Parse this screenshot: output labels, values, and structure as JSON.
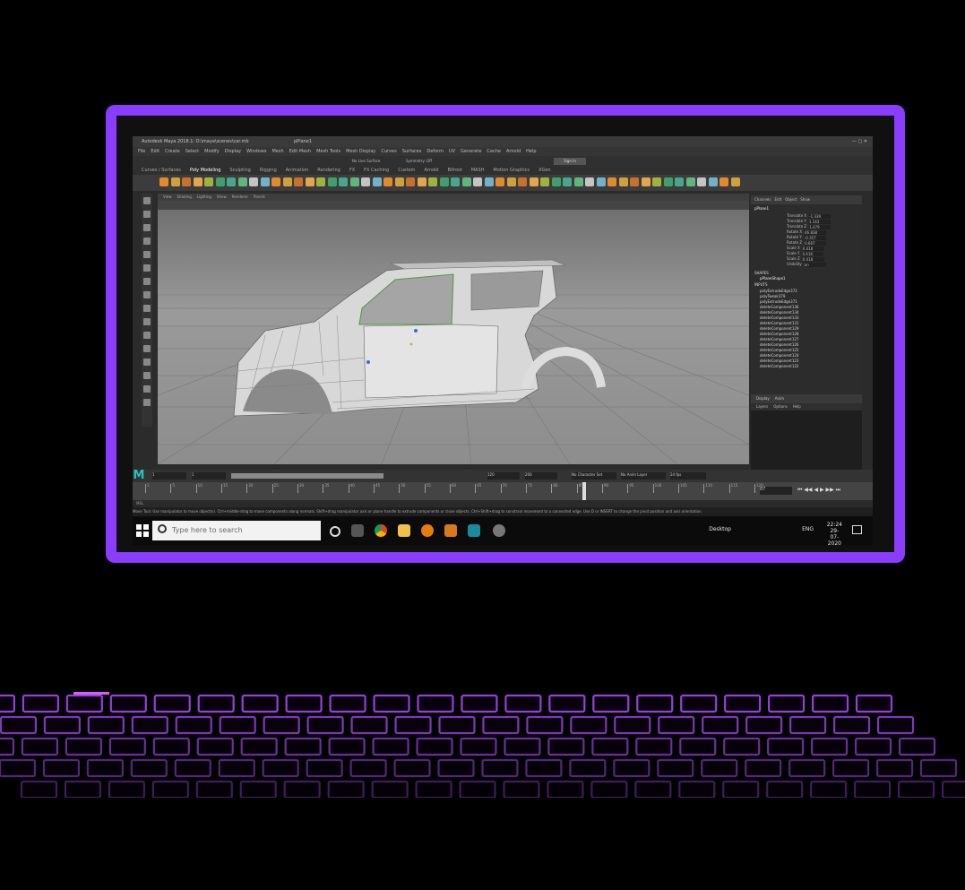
{
  "app": {
    "window_title": "Autodesk Maya 2018.1: D:\\maya\\scenes\\car.mb",
    "object_name": "pPlane1",
    "menus": [
      "File",
      "Edit",
      "Create",
      "Select",
      "Modify",
      "Display",
      "Windows",
      "Mesh",
      "Edit Mesh",
      "Mesh Tools",
      "Mesh Display",
      "Curves",
      "Surfaces",
      "Deform",
      "UV",
      "Generate",
      "Cache",
      "Arnold",
      "Help"
    ],
    "shelf_tabs": [
      "Curves / Surfaces",
      "Poly Modeling",
      "Sculpting",
      "Rigging",
      "Animation",
      "Rendering",
      "FX",
      "FX Caching",
      "Custom",
      "Arnold",
      "Bifrost",
      "MASH",
      "Motion Graphics",
      "XGen"
    ],
    "active_shelf_tab": "Poly Modeling",
    "panel_menus": [
      "View",
      "Shading",
      "Lighting",
      "Show",
      "Renderer",
      "Panels"
    ],
    "sign_in": "Sign In",
    "symmetry": "Symmetry: Off",
    "live_surface": "No Live Surface"
  },
  "channel_box": {
    "tabs": [
      "Channels",
      "Edit",
      "Object",
      "Show"
    ],
    "object": "pPlane1",
    "attributes": [
      {
        "name": "Translate X",
        "value": "-1.339"
      },
      {
        "name": "Translate Y",
        "value": "1.143"
      },
      {
        "name": "Translate Z",
        "value": "1.479"
      },
      {
        "name": "Rotate X",
        "value": "46.838"
      },
      {
        "name": "Rotate Y",
        "value": "-0.357"
      },
      {
        "name": "Rotate Z",
        "value": "0.667"
      },
      {
        "name": "Scale X",
        "value": "0.418"
      },
      {
        "name": "Scale Y",
        "value": "0.418"
      },
      {
        "name": "Scale Z",
        "value": "0.418"
      },
      {
        "name": "Visibility",
        "value": "on"
      }
    ],
    "shapes_label": "SHAPES",
    "shape": "pPlaneShape1",
    "inputs_label": "INPUTS",
    "history": [
      "polyExtrudeEdge372",
      "polyTweak379",
      "polyExtrudeEdge371",
      "deleteComponent136",
      "deleteComponent134",
      "deleteComponent133",
      "deleteComponent131",
      "deleteComponent129",
      "deleteComponent128",
      "deleteComponent127",
      "deleteComponent126",
      "deleteComponent125",
      "deleteComponent124",
      "deleteComponent123",
      "deleteComponent122"
    ]
  },
  "layers": {
    "tabs": [
      "Display",
      "Anim"
    ],
    "menu": [
      "Layers",
      "Options",
      "Help"
    ]
  },
  "time": {
    "start": "1",
    "end": "120",
    "range_end": "200",
    "current": "87",
    "fps": "24 fps",
    "char_set": "No Character Set",
    "anim_layer": "No Anim Layer",
    "ticks": [
      "1",
      "5",
      "10",
      "15",
      "20",
      "25",
      "30",
      "35",
      "40",
      "45",
      "50",
      "55",
      "60",
      "65",
      "70",
      "75",
      "80",
      "85",
      "90",
      "95",
      "100",
      "105",
      "110",
      "115",
      "120"
    ]
  },
  "mel_label": "MEL",
  "help_text": "Move Tool: Use manipulator to move object(s). Ctrl+middle-drag to move components along normals. Shift+drag manipulator axis or plane handle to extrude components or clone objects. Ctrl+Shift+drag to constrain movement to a connected edge. Use D or INSERT to change the pivot position and axis orientation.",
  "taskbar": {
    "search_placeholder": "Type here to search",
    "desktop": "Desktop",
    "language": "ENG",
    "time": "22:24",
    "date": "29-07-2020"
  },
  "colors": {
    "frame": "#8a3cff",
    "keyboard_glow": "#b04dff",
    "maya_teal": "#25c4c4"
  }
}
